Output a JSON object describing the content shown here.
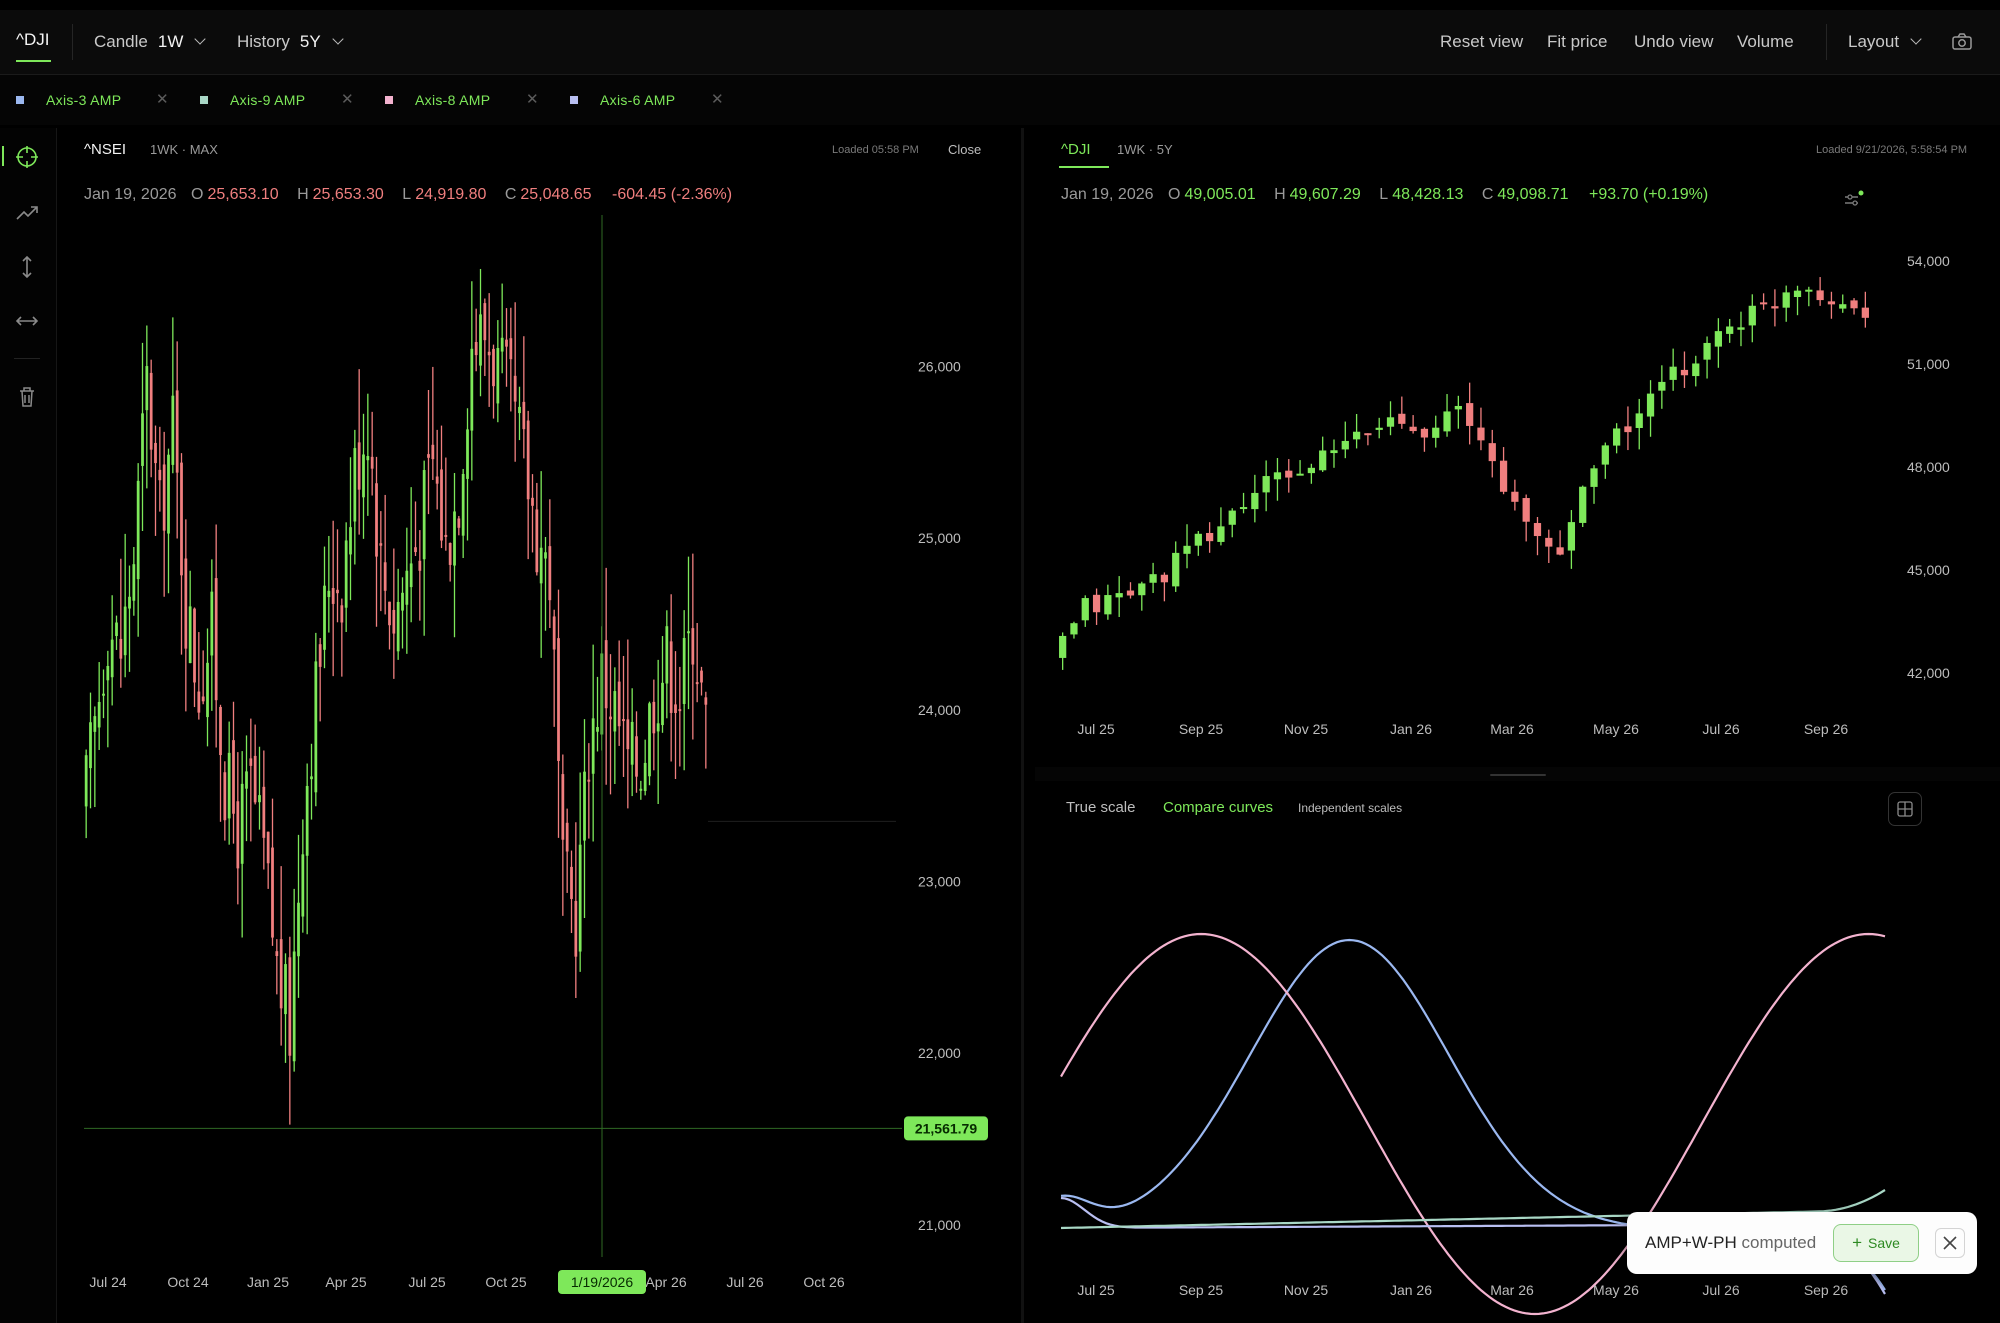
{
  "toolbar": {
    "symbol": "^DJI",
    "chart_type_label": "Candle",
    "interval": "1W",
    "history_label": "History",
    "history_range": "5Y",
    "reset_view": "Reset view",
    "fit_price": "Fit price",
    "undo_view": "Undo view",
    "volume": "Volume",
    "layout": "Layout",
    "icons": [
      "chevron-down-icon",
      "camera-icon"
    ]
  },
  "legend": [
    {
      "label": "Axis-3 AMP",
      "color": "#9bb8f0"
    },
    {
      "label": "Axis-9 AMP",
      "color": "#a9d8c6"
    },
    {
      "label": "Axis-8 AMP",
      "color": "#f3b3cf"
    },
    {
      "label": "Axis-6 AMP",
      "color": "#b9bff2"
    }
  ],
  "rail": [
    "crosshair-icon",
    "trend-line-icon",
    "vertical-measure-icon",
    "horizontal-measure-icon",
    "trash-icon"
  ],
  "colors": {
    "up": "#7ee85a",
    "down": "#f07f7f",
    "accent": "#7ee85a"
  },
  "left_panel": {
    "symbol": "^NSEI",
    "sub": "1WK · MAX",
    "loaded": "Loaded 05:58 PM",
    "close": "Close",
    "ohlc": {
      "date": "Jan 19, 2026",
      "o": "25,653.10",
      "h": "25,653.30",
      "l": "24,919.80",
      "c": "25,048.65",
      "change": "-604.45 (-2.36%)"
    },
    "crosshair_price": "21,561.79",
    "crosshair_date": "1/19/2026"
  },
  "right_panel": {
    "symbol": "^DJI",
    "sub": "1WK · 5Y",
    "loaded": "Loaded 9/21/2026, 5:58:54 PM",
    "ohlc": {
      "date": "Jan 19, 2026",
      "o": "49,005.01",
      "h": "49,607.29",
      "l": "48,428.13",
      "c": "49,098.71",
      "change": "+93.70 (+0.19%)"
    }
  },
  "compare": {
    "tabs": [
      "True scale",
      "Compare curves",
      "Independent scales"
    ],
    "active_tab": "Compare curves",
    "toast_bold": "AMP+W-PH",
    "toast_rest": "computed",
    "save": "Save"
  },
  "chart_data": [
    {
      "type": "candlestick",
      "title": "^NSEI",
      "x_tick_labels": [
        "Jul 24",
        "Oct 24",
        "Jan 25",
        "Apr 25",
        "Jul 25",
        "Oct 25",
        "Jan 26",
        "Apr 26",
        "Jul 26",
        "Oct 26"
      ],
      "y_tick_labels": [
        "26,000",
        "25,000",
        "24,000",
        "23,000",
        "22,000",
        "21,000"
      ],
      "ylim": [
        20900,
        26900
      ],
      "close_path": [
        23350,
        23900,
        24500,
        24350,
        24900,
        25900,
        25100,
        25650,
        24600,
        24150,
        24450,
        23600,
        23300,
        23550,
        23150,
        22500,
        22150,
        23400,
        24100,
        24800,
        24750,
        25400,
        25700,
        24850,
        24550,
        24800,
        25050,
        25450,
        24950,
        25300,
        26150,
        26200,
        26000,
        25800,
        25450,
        25040,
        24800,
        23000,
        22800,
        23800,
        24200,
        24000,
        23700,
        23700,
        24100,
        24300,
        24100,
        24500,
        23900,
        23700
      ],
      "bars_note": "approximately 140 weekly candles, values read from price axis"
    },
    {
      "type": "candlestick",
      "title": "^DJI",
      "x_tick_labels": [
        "Jul 25",
        "Sep 25",
        "Nov 25",
        "Jan 26",
        "Mar 26",
        "May 26",
        "Jul 26",
        "Sep 26"
      ],
      "y_tick_labels": [
        "54,000",
        "51,000",
        "48,000",
        "45,000",
        "42,000"
      ],
      "ylim": [
        41500,
        55200
      ],
      "close_path": [
        42300,
        43900,
        44200,
        44700,
        45500,
        46300,
        47300,
        47800,
        48200,
        48850,
        49400,
        49200,
        49600,
        48200,
        46200,
        45500,
        48300,
        49200,
        50300,
        51200,
        52200,
        52600,
        53400,
        53000,
        52400,
        51900
      ],
      "bars_note": "approximately 62 weekly candles"
    },
    {
      "type": "line",
      "title": "",
      "x_tick_labels": [
        "Jul 25",
        "Sep 25",
        "Nov 25",
        "Jan 26",
        "Mar 26",
        "May 26",
        "Jul 26",
        "Sep 26"
      ],
      "series": [
        {
          "name": "Axis-3 AMP",
          "color": "#9bb8f0",
          "shape": "peaks near Jan 26"
        },
        {
          "name": "Axis-8 AMP",
          "color": "#f3b3cf",
          "shape": "peaks near Sep 25 and end of Sep 26"
        },
        {
          "name": "Axis-6 AMP",
          "color": "#b9bff2",
          "shape": "flat low, rising at end"
        },
        {
          "name": "Axis-9 AMP",
          "color": "#a9d8c6",
          "shape": "flat low, slight rise at end"
        }
      ]
    }
  ]
}
